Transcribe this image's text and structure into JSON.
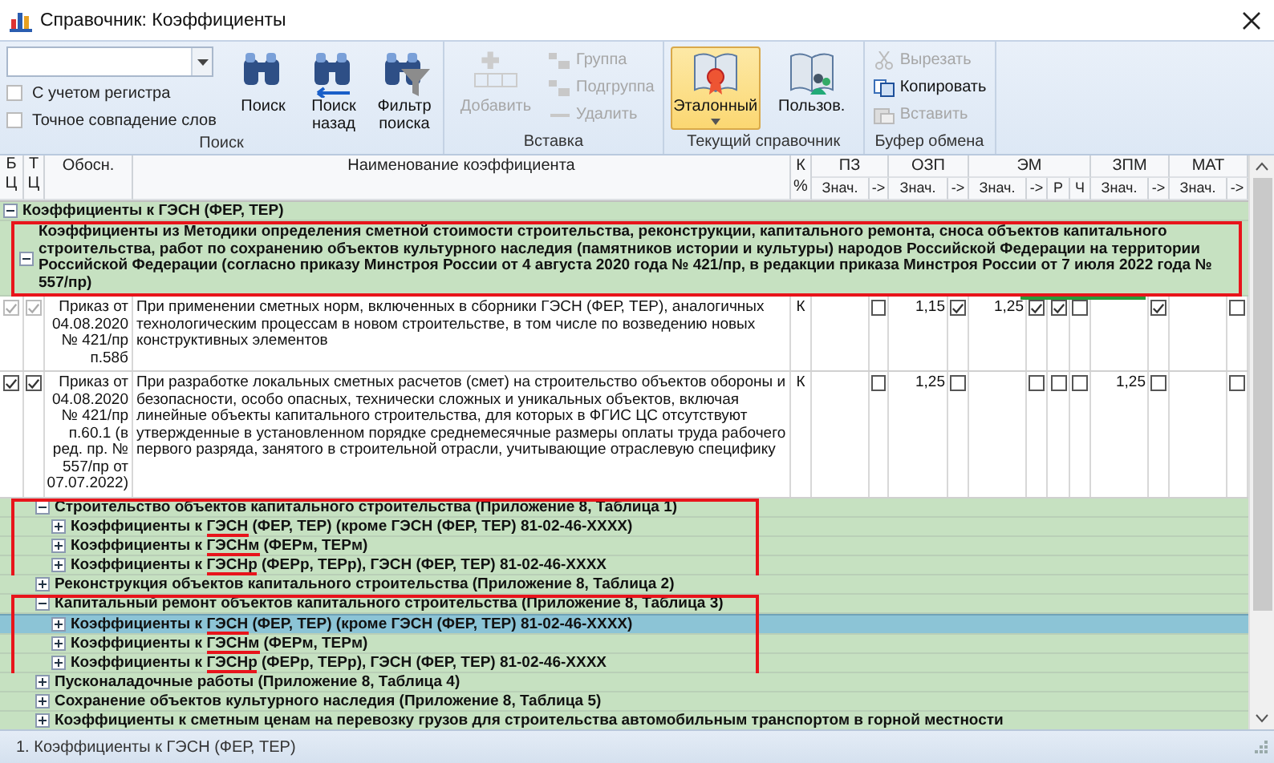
{
  "window": {
    "title": "Справочник: Коэффициенты"
  },
  "ribbon": {
    "search": {
      "label": "Поиск",
      "options": [
        {
          "label": "С учетом регистра",
          "checked": false
        },
        {
          "label": "Точное совпадение слов",
          "checked": false
        }
      ],
      "buttons": [
        {
          "label": "Поиск"
        },
        {
          "label": "Поиск назад"
        },
        {
          "label": "Фильтр поиска"
        }
      ]
    },
    "insert": {
      "label": "Вставка",
      "add": {
        "label": "Добавить",
        "disabled": true
      },
      "actions": [
        {
          "label": "Группа",
          "disabled": true
        },
        {
          "label": "Подгруппа",
          "disabled": true
        },
        {
          "label": "Удалить",
          "disabled": true
        }
      ]
    },
    "current": {
      "label": "Текущий справочник",
      "options": [
        {
          "label": "Эталонный",
          "selected": true
        },
        {
          "label": "Пользов.",
          "selected": false
        }
      ]
    },
    "clipboard": {
      "label": "Буфер обмена",
      "actions": [
        {
          "label": "Вырезать",
          "disabled": true
        },
        {
          "label": "Копировать",
          "disabled": false
        },
        {
          "label": "Вставить",
          "disabled": true
        }
      ]
    }
  },
  "table": {
    "columns": [
      {
        "label": "Б Ц"
      },
      {
        "label": "Т Ц"
      },
      {
        "label": "Обосн."
      },
      {
        "label": "Наименование коэффициента"
      },
      {
        "label": "К %"
      }
    ],
    "column_groups": [
      {
        "label": "ПЗ",
        "subcolumns": [
          "Знач.",
          "->"
        ]
      },
      {
        "label": "ОЗП",
        "subcolumns": [
          "Знач.",
          "->"
        ]
      },
      {
        "label": "ЭМ",
        "subcolumns": [
          "Знач.",
          "->",
          "Р",
          "Ч"
        ]
      },
      {
        "label": "ЗПМ",
        "subcolumns": [
          "Знач.",
          "->"
        ]
      },
      {
        "label": "МАТ",
        "subcolumns": [
          "Знач.",
          "->"
        ]
      }
    ],
    "tree": [
      {
        "label": "Коэффициенты к ГЭСН (ФЕР, ТЕР)",
        "expanded": true,
        "selected": false,
        "children": [
          {
            "label": "Коэффициенты из Методики определения сметной стоимости строительства, реконструкции, капитального ремонта, сноса объектов капитального строительства, работ по сохранению объектов культурного наследия (памятников истории и культуры) народов Российской Федерации на территории Российской Федерации (согласно приказу Минстроя России от 4 августа 2020 года № 421/пр, в редакции приказа Минстроя России от 7 июля 2022 года № 557/пр)",
            "expanded": true,
            "selected": false,
            "framed": true,
            "rows": [
              {
                "bc": true,
                "tc": true,
                "disabled": true,
                "basis": "Приказ от 04.08.2020 № 421/пр п.58б",
                "name": "При применении сметных норм, включенных в сборники ГЭСН (ФЕР, ТЕР), аналогичных технологическим процессам в новом строительстве, в том числе по возведению новых конструктивных элементов",
                "k": "К",
                "cells": [
                  {
                    "kind": "value"
                  },
                  {
                    "kind": "check",
                    "checked": false
                  },
                  {
                    "kind": "value",
                    "text": "1,15"
                  },
                  {
                    "kind": "check",
                    "checked": true
                  },
                  {
                    "kind": "value",
                    "text": "1,25"
                  },
                  {
                    "kind": "check",
                    "checked": true
                  },
                  {
                    "kind": "check",
                    "checked": true
                  },
                  {
                    "kind": "check",
                    "checked": false
                  },
                  {
                    "kind": "value"
                  },
                  {
                    "kind": "check",
                    "checked": true
                  },
                  {
                    "kind": "value"
                  },
                  {
                    "kind": "check",
                    "checked": false
                  }
                ]
              },
              {
                "bc": true,
                "tc": true,
                "disabled": false,
                "basis": "Приказ от 04.08.2020 № 421/пр п.60.1 (в ред. пр. № 557/пр от 07.07.2022)",
                "name": "При разработке локальных сметных расчетов (смет) на строительство объектов обороны и безопасности, особо опасных, технически сложных и уникальных объектов, включая линейные объекты капитального строительства, для которых в ФГИС ЦС отсутствуют утвержденные в установленном порядке среднемесячные размеры оплаты труда рабочего первого разряда, занятого в строительной отрасли, учитывающие отраслевую специфику",
                "k": "К",
                "cells": [
                  {
                    "kind": "value"
                  },
                  {
                    "kind": "check",
                    "checked": false
                  },
                  {
                    "kind": "value",
                    "text": "1,25"
                  },
                  {
                    "kind": "check",
                    "checked": false
                  },
                  {
                    "kind": "value"
                  },
                  {
                    "kind": "check",
                    "checked": false
                  },
                  {
                    "kind": "check",
                    "checked": false
                  },
                  {
                    "kind": "check",
                    "checked": false
                  },
                  {
                    "kind": "value",
                    "text": "1,25"
                  },
                  {
                    "kind": "check",
                    "checked": false
                  },
                  {
                    "kind": "value"
                  },
                  {
                    "kind": "check",
                    "checked": false
                  }
                ]
              }
            ],
            "children": [
              {
                "label": "Строительство объектов капитального строительства (Приложение 8, Таблица 1)",
                "expanded": true,
                "selected": false,
                "framed": true,
                "children": [
                  {
                    "parts": [
                      {
                        "text": "Коэффициенты к ",
                        "marked": false
                      },
                      {
                        "text": "ГЭСН",
                        "marked": true
                      },
                      {
                        "text": " (ФЕР, ТЕР) (кроме ГЭСН (ФЕР, ТЕР) 81-02-46-XXXX)",
                        "marked": false
                      }
                    ],
                    "expanded": false,
                    "selected": false
                  },
                  {
                    "parts": [
                      {
                        "text": "Коэффициенты к ",
                        "marked": false
                      },
                      {
                        "text": "ГЭСНм",
                        "marked": true
                      },
                      {
                        "text": " (ФЕРм, ТЕРм)",
                        "marked": false
                      }
                    ],
                    "expanded": false,
                    "selected": false
                  },
                  {
                    "parts": [
                      {
                        "text": "Коэффициенты к ",
                        "marked": false
                      },
                      {
                        "text": "ГЭСНр",
                        "marked": true
                      },
                      {
                        "text": " (ФЕРр, ТЕРр), ГЭСН (ФЕР, ТЕР) 81-02-46-XXXX",
                        "marked": false
                      }
                    ],
                    "expanded": false,
                    "selected": false
                  }
                ]
              },
              {
                "label": "Реконструкция объектов капитального строительства (Приложение 8, Таблица 2)",
                "expanded": false,
                "selected": false,
                "framed": false
              },
              {
                "label": "Капитальный ремонт объектов капитального строительства (Приложение 8, Таблица 3)",
                "expanded": true,
                "selected": false,
                "framed": true,
                "children": [
                  {
                    "parts": [
                      {
                        "text": "Коэффициенты к ",
                        "marked": false
                      },
                      {
                        "text": "ГЭСН",
                        "marked": true
                      },
                      {
                        "text": " (ФЕР, ТЕР) (кроме ГЭСН (ФЕР, ТЕР) 81-02-46-XXXX)",
                        "marked": false
                      }
                    ],
                    "expanded": false,
                    "selected": true
                  },
                  {
                    "parts": [
                      {
                        "text": "Коэффициенты к ",
                        "marked": false
                      },
                      {
                        "text": "ГЭСНм",
                        "marked": true
                      },
                      {
                        "text": " (ФЕРм, ТЕРм)",
                        "marked": false
                      }
                    ],
                    "expanded": false,
                    "selected": false
                  },
                  {
                    "parts": [
                      {
                        "text": "Коэффициенты к ",
                        "marked": false
                      },
                      {
                        "text": "ГЭСНр",
                        "marked": true
                      },
                      {
                        "text": " (ФЕРр, ТЕРр), ГЭСН (ФЕР, ТЕР) 81-02-46-XXXX",
                        "marked": false
                      }
                    ],
                    "expanded": false,
                    "selected": false
                  }
                ]
              },
              {
                "label": "Пусконаладочные работы (Приложение 8, Таблица 4)",
                "expanded": false,
                "selected": false,
                "framed": false
              },
              {
                "label": "Сохранение объектов культурного наследия (Приложение 8, Таблица 5)",
                "expanded": false,
                "selected": false,
                "framed": false
              },
              {
                "label": "Коэффициенты к сметным ценам на перевозку грузов для строительства автомобильным транспортом в горной местности",
                "expanded": false,
                "selected": false,
                "framed": false
              }
            ]
          }
        ]
      }
    ]
  },
  "status_bar": {
    "text": "1. Коэффициенты к ГЭСН (ФЕР, ТЕР)"
  }
}
